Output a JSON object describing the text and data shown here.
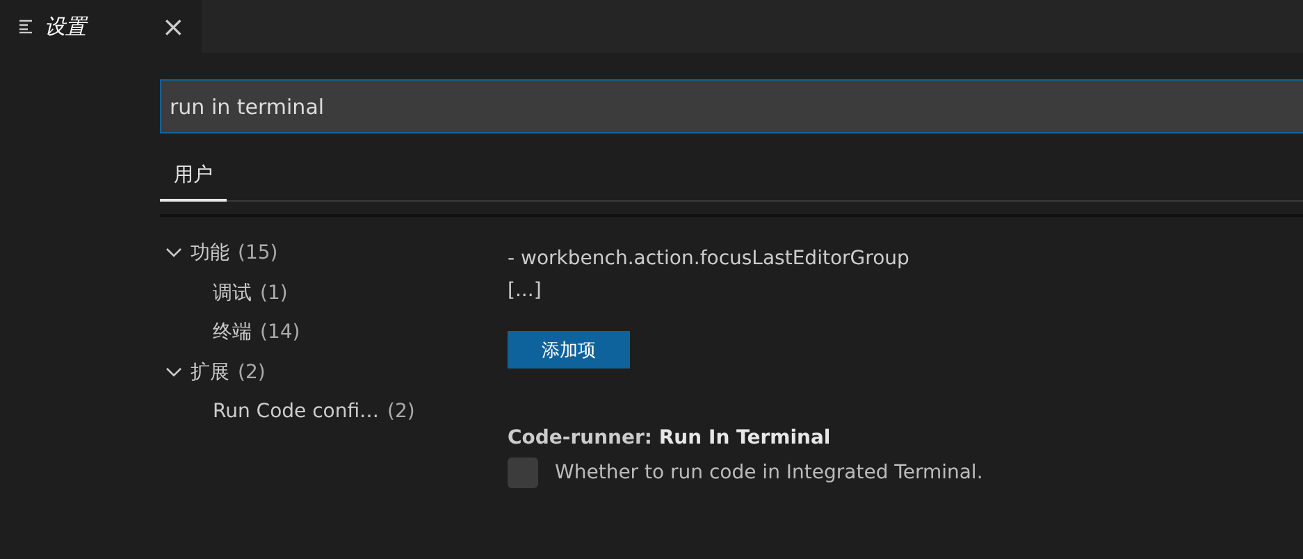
{
  "tab": {
    "title": "设置",
    "close": "×"
  },
  "search": {
    "value": "run in terminal"
  },
  "scopes": [
    {
      "label": "用户",
      "selected": true
    }
  ],
  "tree": [
    {
      "label": "功能",
      "count": "(15)",
      "expanded": true,
      "children": [
        {
          "label": "调试",
          "count": "(1)"
        },
        {
          "label": "终端",
          "count": "(14)"
        }
      ]
    },
    {
      "label": "扩展",
      "count": "(2)",
      "expanded": true,
      "children": [
        {
          "label": "Run Code confi…",
          "count": "(2)"
        }
      ]
    }
  ],
  "list_lines": [
    "- workbench.action.focusLastEditorGroup",
    "[...]"
  ],
  "add_button": "添加项",
  "setting": {
    "title": "Code-runner: **Run In Terminal**",
    "description": "Whether to run code in Integrated Terminal.",
    "checked": false
  }
}
